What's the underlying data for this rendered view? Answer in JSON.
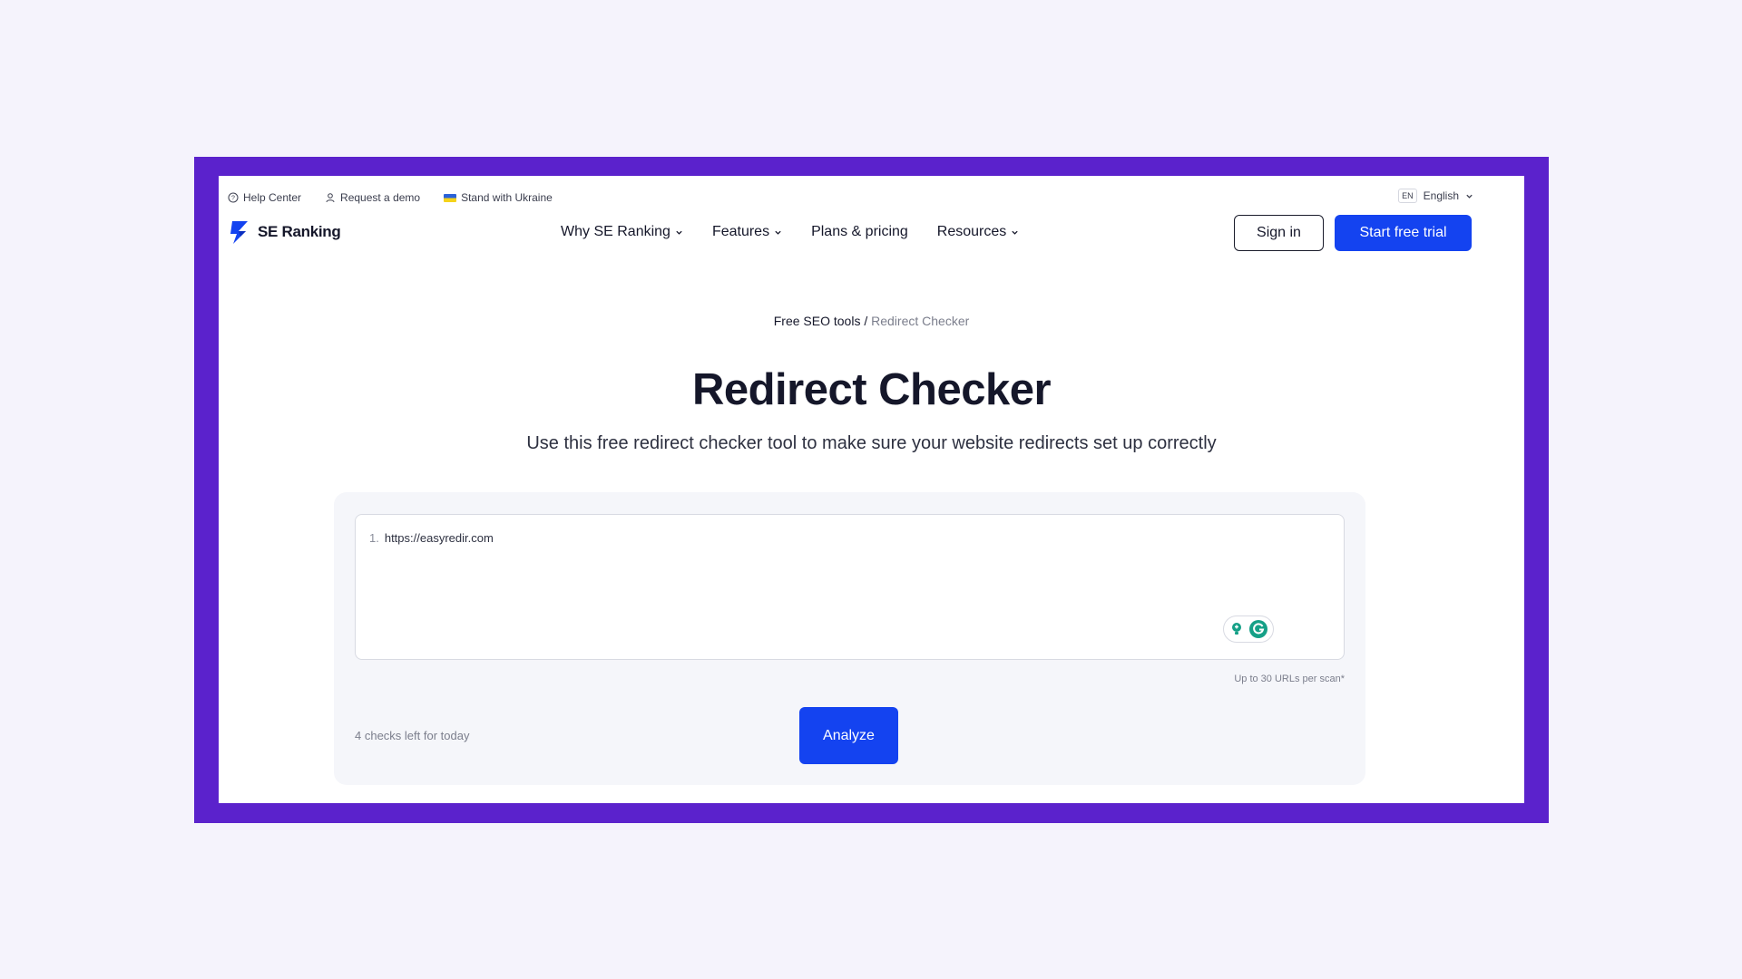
{
  "utility_bar": {
    "help_center": "Help Center",
    "request_demo": "Request a demo",
    "stand_with_ukraine": "Stand with Ukraine",
    "language_code": "EN",
    "language_label": "English"
  },
  "header": {
    "logo_text": "SE Ranking",
    "nav": [
      {
        "label": "Why SE Ranking",
        "has_dropdown": true
      },
      {
        "label": "Features",
        "has_dropdown": true
      },
      {
        "label": "Plans & pricing",
        "has_dropdown": false
      },
      {
        "label": "Resources",
        "has_dropdown": true
      }
    ],
    "sign_in_label": "Sign in",
    "start_trial_label": "Start free trial"
  },
  "hero": {
    "breadcrumb_root": "Free SEO tools",
    "breadcrumb_separator": " / ",
    "breadcrumb_current": "Redirect Checker",
    "title": "Redirect Checker",
    "subtitle": "Use this free redirect checker tool to make sure your website redirects set up correctly"
  },
  "tool": {
    "url_lines": [
      {
        "number": "1.",
        "url": "https://easyredir.com"
      }
    ],
    "limit_hint": "Up to 30 URLs per scan*",
    "checks_left": "4 checks left for today",
    "analyze_label": "Analyze"
  },
  "colors": {
    "frame": "#5b22cc",
    "primary_button": "#1443f0",
    "background": "#f5f3fc",
    "card": "#f5f6fa",
    "grammarly": "#15a087"
  }
}
